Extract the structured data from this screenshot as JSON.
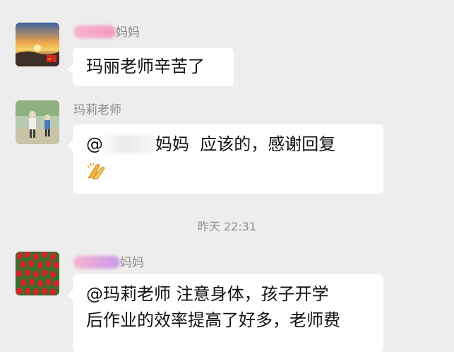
{
  "messages": [
    {
      "sender_suffix": "妈妈",
      "text_lines": [
        "玛丽老师辛苦了"
      ],
      "avatar": "sunset-landscape-with-flag"
    },
    {
      "sender": "玛莉老师",
      "mention_prefix": "@",
      "mention_suffix": "妈妈",
      "text_after_mention": "应该的，感谢回复",
      "emoji": "clapping-hands-icon",
      "avatar": "children-walking-photo"
    },
    {
      "sender_suffix": "妈妈",
      "text_lines": [
        "@玛莉老师  注意身体，孩子开学",
        "后作业的效率提高了好多，老师费"
      ],
      "avatar": "red-tulip-field"
    }
  ],
  "timestamp": "昨天 22:31",
  "colors": {
    "background": "#ededed",
    "bubble": "#ffffff",
    "sender_name": "#8a8a8a",
    "timestamp": "#8e8e8e",
    "redaction_pink": "#f5a6c8",
    "redaction_purple": "#c59ae6"
  }
}
